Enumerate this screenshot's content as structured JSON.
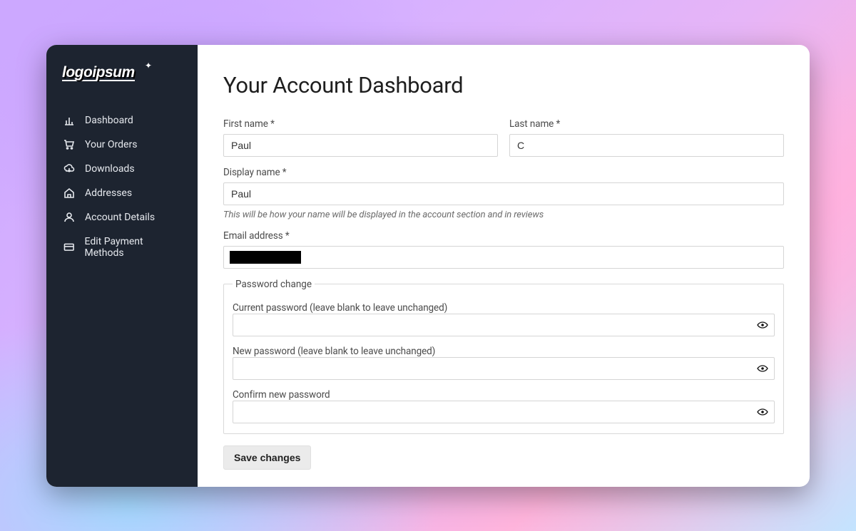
{
  "logo": {
    "text": "logoipsum"
  },
  "sidebar": {
    "items": [
      {
        "label": "Dashboard"
      },
      {
        "label": "Your Orders"
      },
      {
        "label": "Downloads"
      },
      {
        "label": "Addresses"
      },
      {
        "label": "Account Details"
      },
      {
        "label": "Edit Payment Methods"
      }
    ]
  },
  "page": {
    "title": "Your Account Dashboard"
  },
  "form": {
    "first_name_label": "First name *",
    "first_name_value": "Paul",
    "last_name_label": "Last name *",
    "last_name_value": "C",
    "display_name_label": "Display name *",
    "display_name_value": "Paul",
    "display_name_hint": "This will be how your name will be displayed in the account section and in reviews",
    "email_label": "Email address *",
    "email_value_redacted": true,
    "password_legend": "Password change",
    "current_password_label": "Current password (leave blank to leave unchanged)",
    "new_password_label": "New password (leave blank to leave unchanged)",
    "confirm_password_label": "Confirm new password",
    "save_label": "Save changes"
  }
}
